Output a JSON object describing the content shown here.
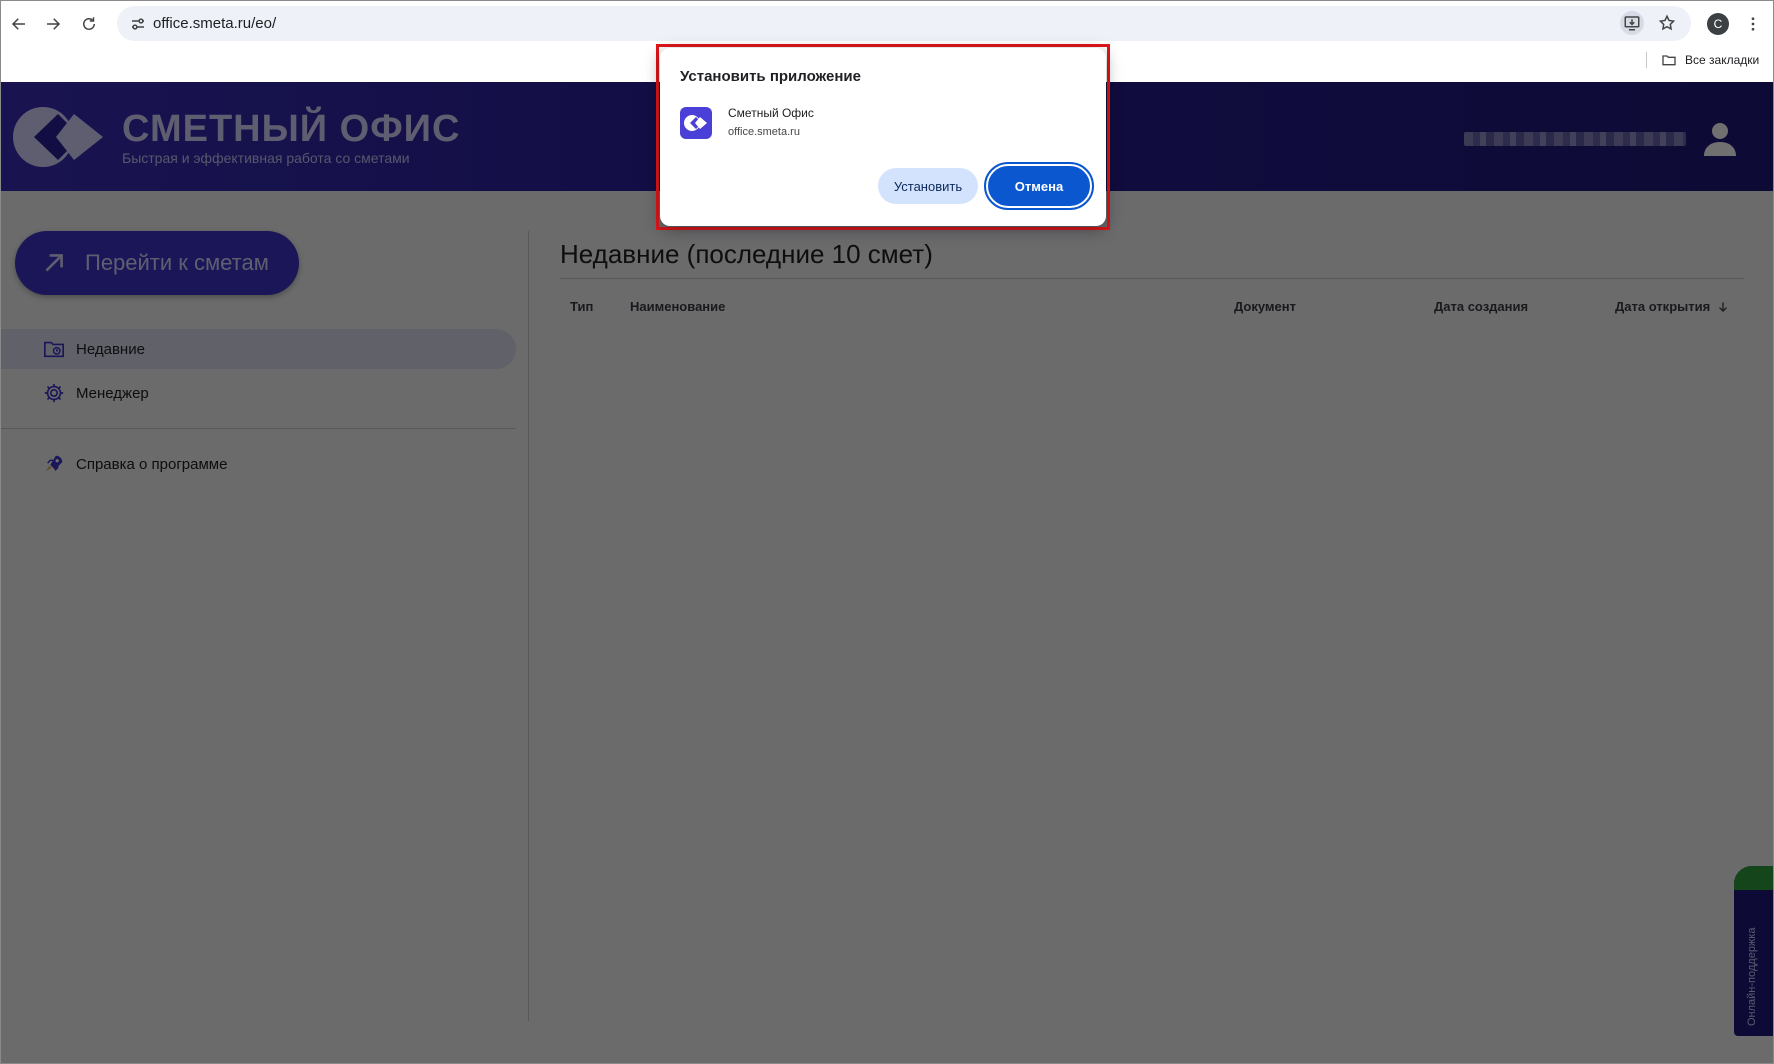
{
  "browser": {
    "url": "office.smeta.ru/eo/",
    "bookmarks_label": "Все закладки",
    "profile_initial": "C",
    "icons": [
      "back-arrow-icon",
      "forward-arrow-icon",
      "reload-icon",
      "site-settings-icon",
      "install-app-icon",
      "star-icon",
      "kebab-menu-icon",
      "folder-icon"
    ]
  },
  "header": {
    "title": "СМЕТНЫЙ ОФИС",
    "subtitle": "Быстрая и эффективная работа со сметами"
  },
  "sidebar": {
    "go_button_label": "Перейти к сметам",
    "items": [
      {
        "label": "Недавние",
        "icon": "folder-clock-icon",
        "active": true
      },
      {
        "label": "Менеджер",
        "icon": "gear-icon",
        "active": false
      },
      {
        "label": "Справка о программе",
        "icon": "rocket-icon",
        "active": false
      }
    ]
  },
  "main": {
    "title": "Недавние (последние 10 смет)",
    "columns": [
      "Тип",
      "Наименование",
      "Документ",
      "Дата создания",
      "Дата открытия"
    ],
    "sort_icon": "arrow-down-icon"
  },
  "support_tab": {
    "label": "Онлайн-поддержка"
  },
  "dialog": {
    "title": "Установить приложение",
    "app_name": "Сметный Офис",
    "app_url": "office.smeta.ru",
    "install_label": "Установить",
    "cancel_label": "Отмена"
  },
  "colors": {
    "header_bg": "#2a1f9a",
    "accent": "#3b34c9",
    "dialog_primary": "#0b57d0",
    "dialog_secondary": "#d3e3fd",
    "highlight_border": "#e0161b"
  }
}
